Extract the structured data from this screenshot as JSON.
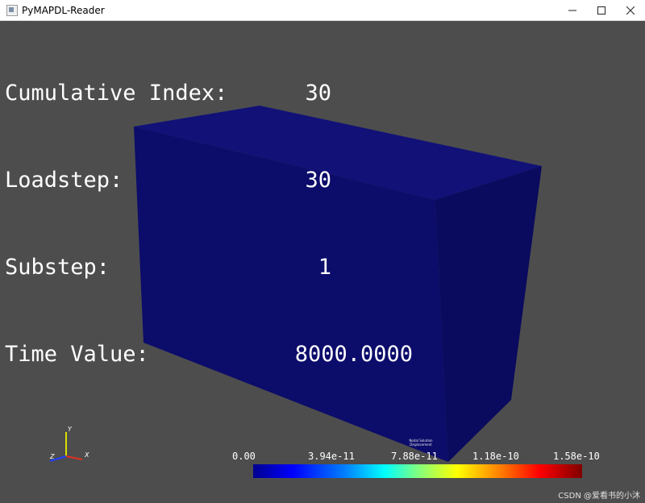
{
  "window": {
    "title": "PyMAPDL-Reader"
  },
  "info": {
    "cumulative_index_label": "Cumulative Index:",
    "cumulative_index_value": "30",
    "loadstep_label": "Loadstep:",
    "loadstep_value": "30",
    "substep_label": "Substep:",
    "substep_value": "1",
    "time_value_label": "Time Value:",
    "time_value_value": "8000.0000"
  },
  "scalar_bar": {
    "title": "Nodal Solution Displacement",
    "ticks": [
      "0.00",
      "3.94e-11",
      "7.88e-11",
      "1.18e-10",
      "1.58e-10"
    ]
  },
  "axes": {
    "x": "X",
    "y": "Y",
    "z": "Z"
  },
  "watermark": "CSDN @爱看书的小沐",
  "colors": {
    "background": "#4d4d4d",
    "box_front": "#0c0c6b",
    "box_side": "#0a0a5e",
    "box_top": "#111178"
  }
}
